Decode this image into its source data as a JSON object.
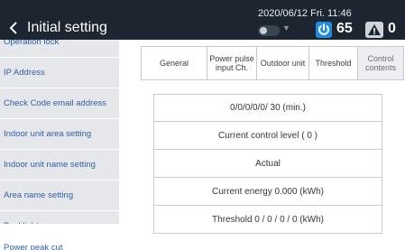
{
  "header": {
    "title": "Initial setting",
    "datetime": "2020/06/12 Fri. 11:46",
    "power_count": "65",
    "warning_count": "0",
    "colors": {
      "background": "#1d2530",
      "power_icon": "#1f8ce0"
    }
  },
  "sidebar": {
    "items": [
      {
        "label": "Operation lock"
      },
      {
        "label": "IP Address"
      },
      {
        "label": "Check Code email address"
      },
      {
        "label": "Indoor unit area setting"
      },
      {
        "label": "Indoor unit name setting"
      },
      {
        "label": "Area name setting"
      },
      {
        "label": "Backlight"
      },
      {
        "label": "Power peak cut",
        "active": true
      }
    ]
  },
  "tabs": [
    {
      "label": "General"
    },
    {
      "label": "Power pulse input Ch."
    },
    {
      "label": "Outdoor unit"
    },
    {
      "label": "Threshold"
    },
    {
      "label": "Control contents",
      "active": true
    }
  ],
  "content": {
    "rows": [
      "0/0/0/0/0/  30 (min.)",
      "Current control level ( 0 )",
      "Actual",
      "Current energy 0.000 (kWh)",
      "Threshold 0 / 0 / 0 / 0 (kWh)"
    ]
  },
  "icons": {
    "back": "chevron-left-icon",
    "power": "power-icon",
    "warning": "warning-icon",
    "toggle": "toggle-icon",
    "dropdown": "dropdown-arrow-icon"
  }
}
